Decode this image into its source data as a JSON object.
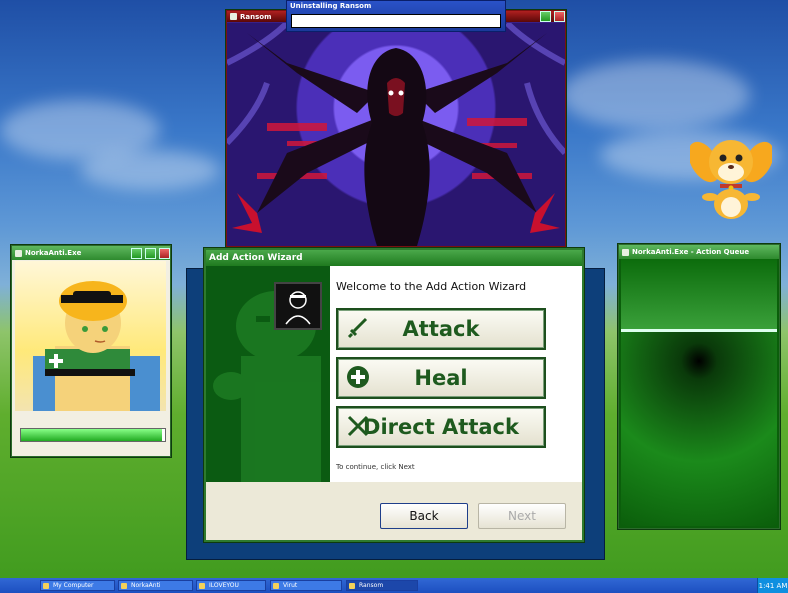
{
  "windows": {
    "ransom_title": "Ransom",
    "uninstall_title": "Uninstalling Ransom",
    "portrait_title": "NorkaAnti.Exe",
    "portrait_hp": 0.98,
    "queue_title": "NorkaAnti.Exe - Action Queue"
  },
  "wizard": {
    "title": "Add Action Wizard",
    "welcome": "Welcome to the Add Action Wizard",
    "actions": [
      "Attack",
      "Heal",
      "Direct Attack"
    ],
    "hint": "To continue, click Next",
    "back_label": "Back",
    "next_label": "Next"
  },
  "taskbar": {
    "items": [
      "My Computer",
      "NorkaAnti",
      "ILOVEYOU",
      "Virut",
      "Ransom"
    ],
    "clock": "1:41 AM"
  },
  "colors": {
    "accent_green": "#1f7a1f",
    "ransom_red": "#b02020",
    "taskbar_blue": "#1c4fc0"
  }
}
